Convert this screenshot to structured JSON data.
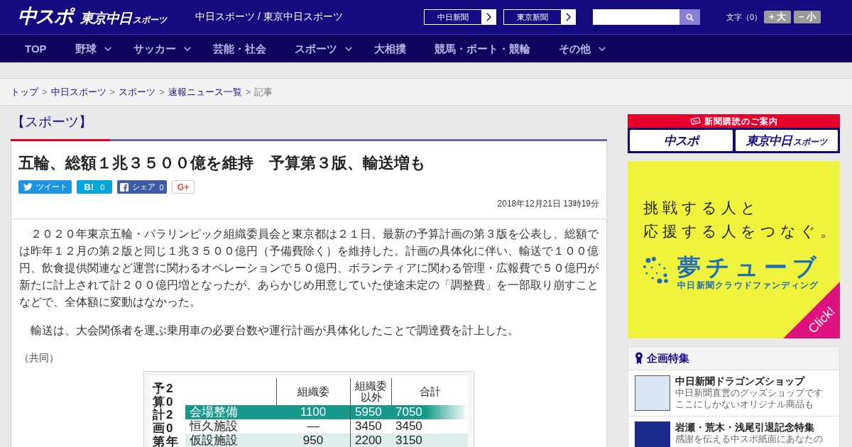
{
  "header": {
    "logo": {
      "main": "中スポ",
      "sub": "東京中日",
      "sub_suffix": "スポーツ"
    },
    "site_names": "中日スポーツ / 東京中日スポーツ",
    "newspaper_links": [
      "中日新聞",
      "東京新聞"
    ],
    "font_size": {
      "label": "文字（0）",
      "buttons": [
        "+ 大",
        "− 小"
      ]
    }
  },
  "nav": [
    {
      "label": "TOP",
      "dropdown": false
    },
    {
      "label": "野球",
      "dropdown": true
    },
    {
      "label": "サッカー",
      "dropdown": true
    },
    {
      "label": "芸能・社会",
      "dropdown": false
    },
    {
      "label": "スポーツ",
      "dropdown": true
    },
    {
      "label": "大相撲",
      "dropdown": false
    },
    {
      "label": "競馬・ボート・競輪",
      "dropdown": false
    },
    {
      "label": "その他",
      "dropdown": true
    }
  ],
  "breadcrumb": [
    {
      "label": "トップ",
      "link": true
    },
    {
      "separator": ">",
      "label": "中日スポーツ",
      "link": true
    },
    {
      "separator": ">",
      "label": "スポーツ",
      "link": true
    },
    {
      "separator": ">",
      "label": "速報ニュース一覧",
      "link": true
    },
    {
      "separator": ">",
      "label": "記事",
      "link": false
    }
  ],
  "category": "【スポーツ】",
  "article": {
    "title": "五輪、総額１兆３５００億を維持　予算第３版、輸送増も",
    "share": [
      {
        "kind": "twitter",
        "label": "ツイート"
      },
      {
        "kind": "hatena",
        "label": "B!",
        "count": "0"
      },
      {
        "kind": "facebook",
        "label": "シェア",
        "count": "0"
      },
      {
        "kind": "googleplus",
        "label": "G+"
      }
    ],
    "date": "2018年12月21日 13時19分",
    "paragraphs": [
      "　２０２０年東京五輪・パラリンピック組織委員会と東京都は２１日、最新の予算計画の第３版を公表し、総額では昨年１２月の第２版と同じ１兆３５００億円（予備費除く）を維持した。計画の具体化に伴い、輸送で１００億円、飲食提供関連など運営に関わるオペレーションで５０億円、ボランティアに関わる管理・広報費で５０億円が新たに計上されて計２００億円増となったが、あらかじめ用意していた使途未定の「調整費」を一部取り崩すことなどで、全体額に変動はなかった。",
      "　輸送は、大会関係者を運ぶ乗用車の必要台数や運行計画が具体化したことで調達費を計上した。"
    ],
    "credit": "（共同）",
    "figure": {
      "title_columns": [
        "予算計画第",
        "2020年"
      ],
      "columns": [
        "組織委",
        "組織委以外",
        "合計"
      ],
      "rows": [
        {
          "kind": "group",
          "label": "会場整備",
          "cells": [
            "1100",
            "5950",
            "7050"
          ]
        },
        {
          "kind": "plain",
          "label": "恒久施設",
          "cells": [
            "—",
            "3450",
            "3450"
          ]
        },
        {
          "kind": "shaded",
          "label": "仮設施設",
          "cells": [
            "950",
            "2200",
            "3150"
          ]
        }
      ]
    }
  },
  "sidebar": {
    "subscribe": {
      "title": "新聞購読のご案内",
      "papers": [
        {
          "name": "中スポ"
        },
        {
          "name": "東京中日",
          "suffix": "スポーツ"
        }
      ]
    },
    "ad": {
      "lines": [
        "挑戦する人と",
        "応援する人をつなぐ。"
      ],
      "brand": "夢チューブ",
      "tagline": "中日新聞クラウドファンディング",
      "corner": "Click!"
    },
    "features": {
      "title": "企画特集",
      "items": [
        {
          "title": "中日新聞ドラゴンズショップ",
          "lines": [
            "中日新聞直営のグッズショップです",
            "ここにしかないオリジナル商品も"
          ]
        },
        {
          "title": "岩瀬・荒木・浅尾引退記念特集",
          "lines": [
            "感謝を伝える中スポ紙面にあなたの"
          ]
        }
      ]
    }
  }
}
